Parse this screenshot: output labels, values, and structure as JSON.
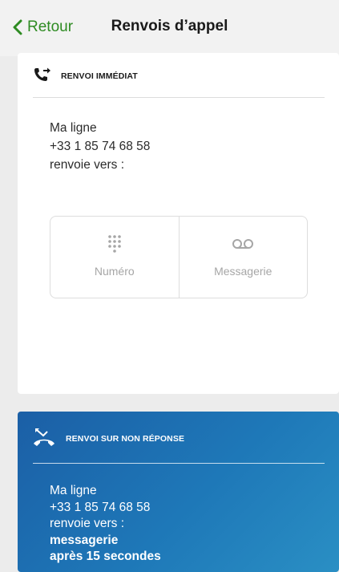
{
  "nav": {
    "back_label": "Retour",
    "title": "Renvois d’appel"
  },
  "immediate": {
    "title": "RENVOI IMMÉDIAT",
    "icon": "call-forward-icon",
    "line_label": "Ma ligne",
    "number": "+33 1 85 74 68 58",
    "forwards_to": "renvoie vers :",
    "options": [
      {
        "label": "Numéro",
        "icon": "dialpad-icon"
      },
      {
        "label": "Messagerie",
        "icon": "voicemail-icon"
      }
    ]
  },
  "no_answer": {
    "title": "RENVOI SUR NON RÉPONSE",
    "icon": "missed-call-icon",
    "line_label": "Ma ligne",
    "number": "+33 1 85 74 68 58",
    "forwards_to": "renvoie vers :",
    "target": "messagerie",
    "delay": "après 15 secondes"
  },
  "colors": {
    "accent_green": "#2e8b22",
    "card_blue": "#1e78b8"
  }
}
